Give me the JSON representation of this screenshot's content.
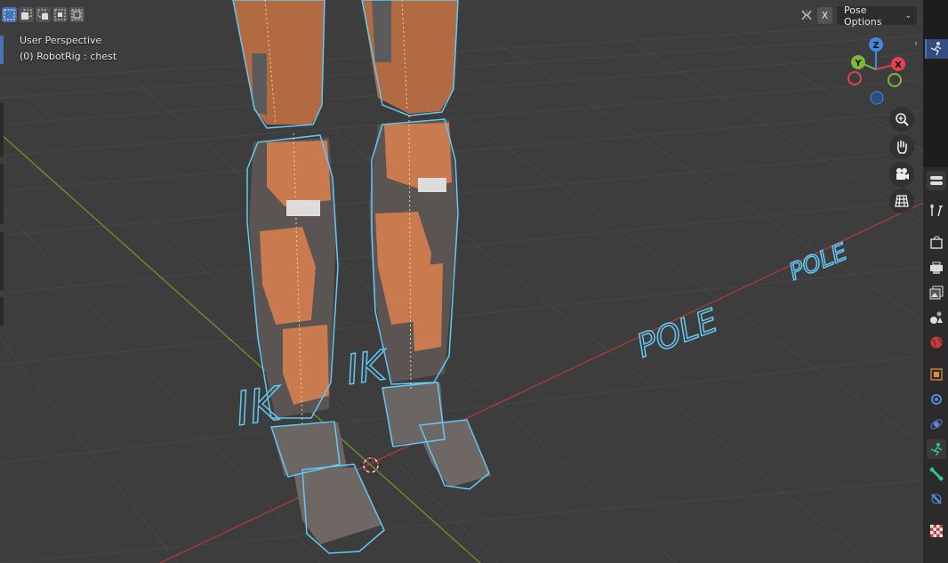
{
  "viewport": {
    "perspective_label": "User Perspective",
    "object_label": "(0) RobotRig : chest"
  },
  "header": {
    "selection_modes": [
      "select-box-new-icon",
      "select-box-extend-icon",
      "select-box-subtract-icon",
      "select-box-invert-icon",
      "select-box-intersect-icon"
    ],
    "x_mirror_label": "X",
    "pose_options_label": "Pose Options"
  },
  "gizmo": {
    "z_label": "Z",
    "y_label": "Y",
    "x_label": "X",
    "colors": {
      "x": "#e0434f",
      "y": "#7fb833",
      "z": "#3f8ae0"
    }
  },
  "nav_buttons": [
    "zoom-icon",
    "pan-hand-icon",
    "camera-icon",
    "grid-ortho-icon"
  ],
  "scene_labels": {
    "ik_left": "IK",
    "ik_right": "IK",
    "pole_near": "POLE",
    "pole_far": "POLE"
  },
  "colors": {
    "bone_outline": "#62c8f5",
    "robot_orange": "#c97a4e",
    "axis_red": "#a63a3e",
    "axis_green": "#6d8e2c",
    "accent": "#4772b3"
  },
  "properties_tabs": [
    "tool-icon",
    "render-icon",
    "output-icon",
    "view-layer-icon",
    "scene-icon",
    "world-icon",
    "object-icon",
    "modifier-icon",
    "physics-icon",
    "object-data-armature-icon",
    "bone-icon",
    "bone-constraint-icon",
    "texture-icon"
  ]
}
